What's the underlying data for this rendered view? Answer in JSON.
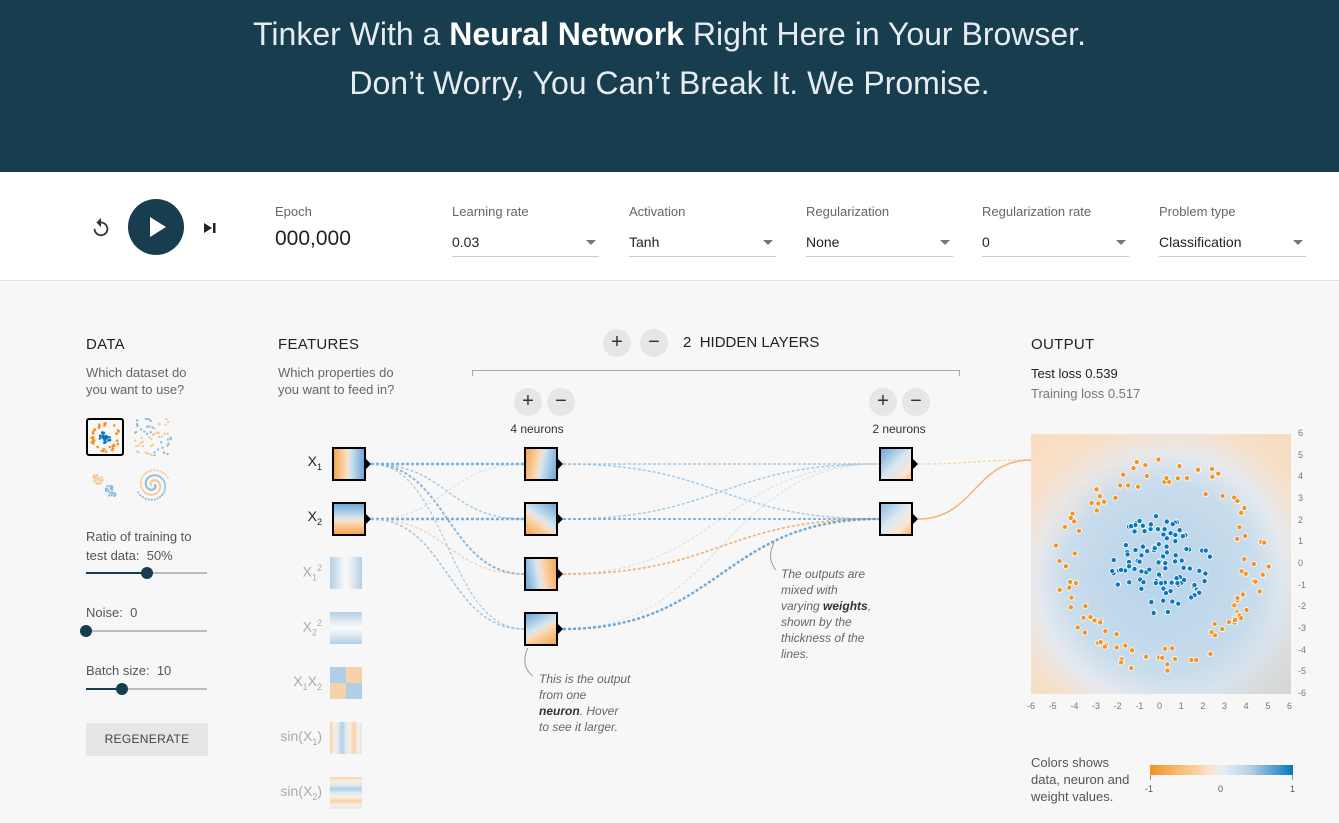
{
  "header": {
    "line1_pre": "Tinker With a ",
    "line1_bold": "Neural Network",
    "line1_post": " Right Here in Your Browser.",
    "line2": "Don’t Worry, You Can’t Break It. We Promise."
  },
  "toolbar": {
    "epoch_label": "Epoch",
    "epoch_value": "000,000",
    "controls": [
      {
        "label": "Learning rate",
        "value": "0.03"
      },
      {
        "label": "Activation",
        "value": "Tanh"
      },
      {
        "label": "Regularization",
        "value": "None"
      },
      {
        "label": "Regularization rate",
        "value": "0"
      },
      {
        "label": "Problem type",
        "value": "Classification"
      }
    ]
  },
  "data_panel": {
    "title": "DATA",
    "subtitle_1": "Which dataset do",
    "subtitle_2": "you want to use?",
    "ratio_label_1": "Ratio of training to",
    "ratio_label_2": "test data:",
    "ratio_value": "50%",
    "ratio_fraction": 0.5,
    "noise_label": "Noise:",
    "noise_value": "0",
    "noise_fraction": 0,
    "batch_label": "Batch size:",
    "batch_value": "10",
    "batch_fraction": 0.3,
    "regenerate": "REGENERATE",
    "selected_dataset": "circle"
  },
  "features_panel": {
    "title": "FEATURES",
    "subtitle_1": "Which properties do",
    "subtitle_2": "you want to feed in?",
    "features": [
      {
        "name": "X",
        "sub": "1",
        "sup": "",
        "active": true
      },
      {
        "name": "X",
        "sub": "2",
        "sup": "",
        "active": true
      },
      {
        "name": "X",
        "sub": "1",
        "sup": "2",
        "active": false
      },
      {
        "name": "X",
        "sub": "2",
        "sup": "2",
        "active": false
      },
      {
        "name": "X",
        "sub": "1",
        "name2": "X",
        "sub2": "2",
        "active": false
      },
      {
        "name": "sin(X",
        "sub": "1",
        "post": ")",
        "active": false
      },
      {
        "name": "sin(X",
        "sub": "2",
        "post": ")",
        "active": false
      }
    ]
  },
  "network": {
    "layer_count": "2",
    "layers_label": "HIDDEN LAYERS",
    "layer1_neurons": "4 neurons",
    "layer2_neurons": "2 neurons",
    "annotation_neuron_1": "This is the output",
    "annotation_neuron_2": "from one",
    "annotation_neuron_bold": "neuron",
    "annotation_neuron_3": ". Hover",
    "annotation_neuron_4": "to see it larger.",
    "annotation_weights_1": "The outputs are",
    "annotation_weights_2": "mixed with",
    "annotation_weights_3": "varying ",
    "annotation_weights_bold": "weights",
    "annotation_weights_4": ",",
    "annotation_weights_5": "shown by the",
    "annotation_weights_6": "thickness of the",
    "annotation_weights_7": "lines."
  },
  "output_panel": {
    "title": "OUTPUT",
    "test_loss_label": "Test loss",
    "test_loss_value": "0.539",
    "training_loss_label": "Training loss",
    "training_loss_value": "0.517",
    "x_ticks": [
      "-6",
      "-5",
      "-4",
      "-3",
      "-2",
      "-1",
      "0",
      "1",
      "2",
      "3",
      "4",
      "5",
      "6"
    ],
    "y_ticks": [
      "6",
      "5",
      "4",
      "3",
      "2",
      "1",
      "0",
      "-1",
      "-2",
      "-3",
      "-4",
      "-5",
      "-6"
    ],
    "legend_1": "Colors shows",
    "legend_2": "data, neuron and",
    "legend_3": "weight values.",
    "colorbar_min": "-1",
    "colorbar_mid": "0",
    "colorbar_max": "1"
  },
  "colors": {
    "header_bg": "#183d4e",
    "orange": "#f59322",
    "blue": "#0877bd"
  }
}
